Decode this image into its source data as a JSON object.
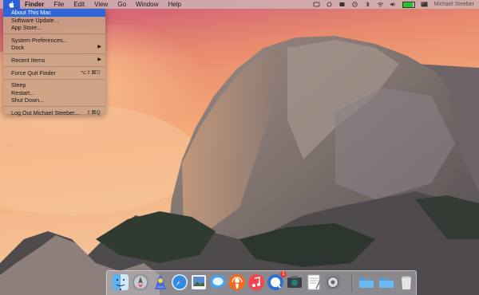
{
  "menubar": {
    "apple_icon": "apple-logo-icon",
    "app_name": "Finder",
    "menus": [
      "File",
      "Edit",
      "View",
      "Go",
      "Window",
      "Help"
    ],
    "battery_level_percent": 85,
    "battery_color": "#2cc22c",
    "user_name": "Michael Steeber"
  },
  "apple_menu": {
    "highlight_color": "#2c66d8",
    "items": {
      "about": "About This Mac",
      "software_update": "Software Update...",
      "app_store": "App Store...",
      "system_prefs": "System Preferences...",
      "dock": "Dock",
      "recent_items": "Recent Items",
      "force_quit": "Force Quit Finder",
      "force_quit_shortcut": "⌥⇧⌘⎋",
      "sleep": "Sleep",
      "restart": "Restart...",
      "shutdown": "Shut Down...",
      "logout": "Log Out Michael Steeber...",
      "logout_shortcut": "⇧⌘Q"
    }
  },
  "dock": {
    "apps": [
      "finder-icon",
      "launchpad-icon",
      "cleaner-icon",
      "safari-icon",
      "preview-icon",
      "messages-icon",
      "podcast-icon",
      "music-icon",
      "chat-icon",
      "camera-icon",
      "textedit-icon",
      "system-preferences-icon"
    ],
    "folders": [
      "applications-folder-icon",
      "documents-folder-icon",
      "trash-icon"
    ],
    "chat_badge": "1"
  }
}
